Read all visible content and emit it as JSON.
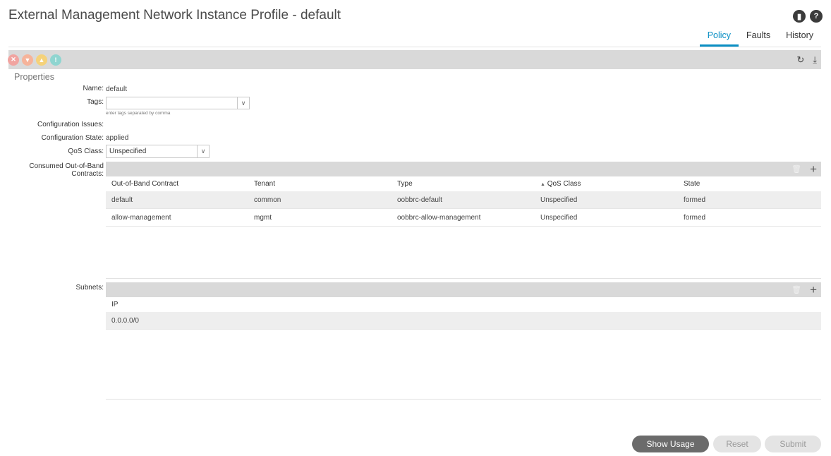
{
  "page": {
    "title": "External Management Network Instance Profile - default"
  },
  "tabs": [
    {
      "label": "Policy",
      "active": true
    },
    {
      "label": "Faults",
      "active": false
    },
    {
      "label": "History",
      "active": false
    }
  ],
  "toolbar": {
    "refresh_icon": "refresh-icon",
    "download_icon": "download-icon"
  },
  "properties": {
    "section_title": "Properties",
    "name_label": "Name:",
    "name_value": "default",
    "tags_label": "Tags:",
    "tags_value": "",
    "tags_hint": "enter tags separated by comma",
    "config_issues_label": "Configuration Issues:",
    "config_state_label": "Configuration State:",
    "config_state_value": "applied",
    "qos_label": "QoS Class:",
    "qos_value": "Unspecified",
    "contracts_label_1": "Consumed Out-of-Band",
    "contracts_label_2": "Contracts:",
    "subnets_label": "Subnets:"
  },
  "contracts_table": {
    "columns": [
      "Out-of-Band Contract",
      "Tenant",
      "Type",
      "QoS Class",
      "State"
    ],
    "sort_column": "QoS Class",
    "rows": [
      [
        "default",
        "common",
        "oobbrc-default",
        "Unspecified",
        "formed"
      ],
      [
        "allow-management",
        "mgmt",
        "oobbrc-allow-management",
        "Unspecified",
        "formed"
      ]
    ]
  },
  "subnets_table": {
    "columns": [
      "IP"
    ],
    "rows": [
      [
        "0.0.0.0/0"
      ]
    ]
  },
  "buttons": {
    "show_usage": "Show Usage",
    "reset": "Reset",
    "submit": "Submit"
  }
}
